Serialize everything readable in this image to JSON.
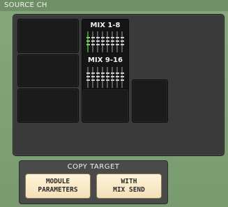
{
  "header": {
    "title": "SOURCE CH"
  },
  "mix_blocks": [
    {
      "label": "MIX 1-8",
      "selected_fader": 1
    },
    {
      "label": "MIX 9-16"
    }
  ],
  "copy_target": {
    "title": "COPY TARGET",
    "buttons": [
      {
        "label": "MODULE\nPARAMETERS"
      },
      {
        "label": "WITH\nMIX SEND"
      }
    ]
  },
  "colors": {
    "background": "#7e9f74",
    "panel": "#3a3a3a",
    "slot": "#1b1b1b",
    "button": "#f3e0b8",
    "fader_active": "#7bd36a"
  }
}
